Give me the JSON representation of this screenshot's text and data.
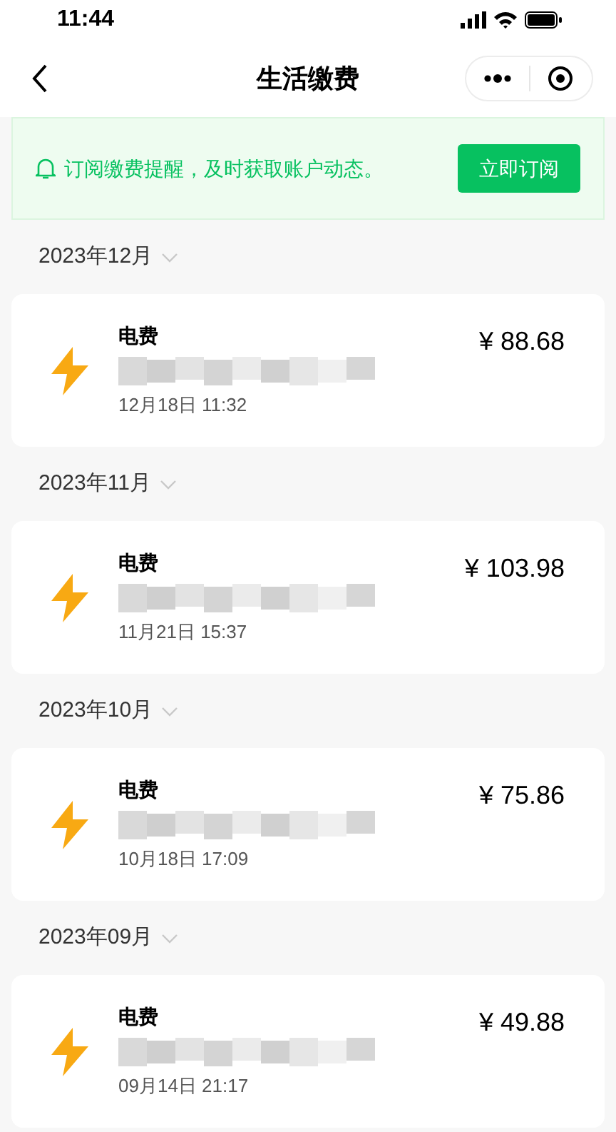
{
  "status_bar": {
    "time": "11:44"
  },
  "nav": {
    "title": "生活缴费"
  },
  "banner": {
    "text": "订阅缴费提醒，及时获取账户动态。",
    "button": "立即订阅"
  },
  "groups": [
    {
      "month": "2023年12月",
      "bill": {
        "name": "电费",
        "amount": "¥ 88.68",
        "date": "12月18日 11:32"
      }
    },
    {
      "month": "2023年11月",
      "bill": {
        "name": "电费",
        "amount": "¥ 103.98",
        "date": "11月21日 15:37"
      }
    },
    {
      "month": "2023年10月",
      "bill": {
        "name": "电费",
        "amount": "¥ 75.86",
        "date": "10月18日 17:09"
      }
    },
    {
      "month": "2023年09月",
      "bill": {
        "name": "电费",
        "amount": "¥ 49.88",
        "date": "09月14日 21:17"
      }
    }
  ]
}
